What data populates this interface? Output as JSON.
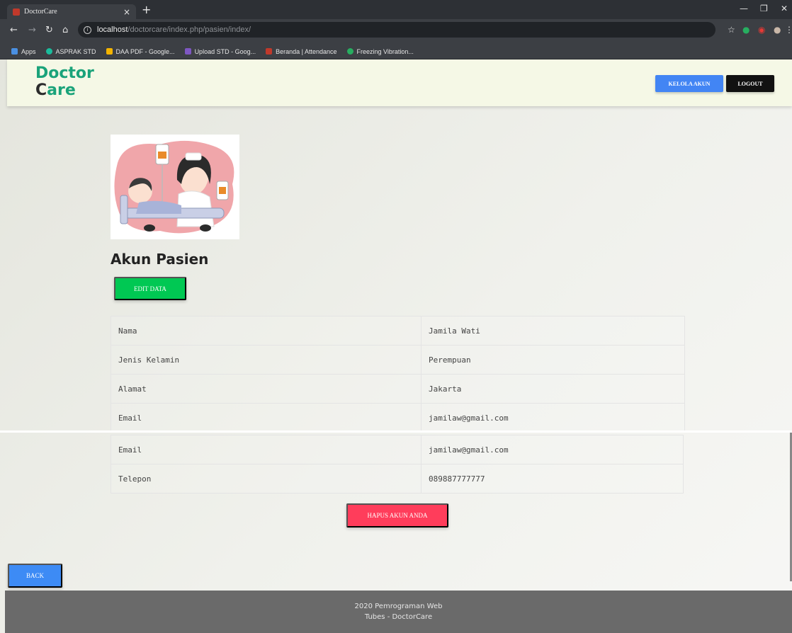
{
  "browser": {
    "tab_title": "DoctorCare",
    "url_host": "localhost",
    "url_path": "/doctorcare/index.php/pasien/index/",
    "bookmarks": [
      {
        "label": "Apps",
        "color": "#4a90e2"
      },
      {
        "label": "ASPRAK STD",
        "color": "#1abc9c"
      },
      {
        "label": "DAA PDF - Google...",
        "color": "#f4b400"
      },
      {
        "label": "Upload STD - Goog...",
        "color": "#7e57c2"
      },
      {
        "label": "Beranda | Attendance",
        "color": "#c0392b"
      },
      {
        "label": "Freezing Vibration...",
        "color": "#27ae60"
      }
    ]
  },
  "header": {
    "logo_line1": "Doctor",
    "logo_line2": "are",
    "kelola_label": "KELOLA AKUN",
    "logout_label": "LOGOUT"
  },
  "main": {
    "title": "Akun Pasien",
    "edit_label": "EDIT DATA",
    "rows_top": [
      {
        "label": "Nama",
        "value": "Jamila Wati"
      },
      {
        "label": "Jenis Kelamin",
        "value": "Perempuan"
      },
      {
        "label": "Alamat",
        "value": "Jakarta"
      },
      {
        "label": "Email",
        "value": "jamilaw@gmail.com"
      }
    ],
    "rows_bottom": [
      {
        "label": "Email",
        "value": "jamilaw@gmail.com"
      },
      {
        "label": "Telepon",
        "value": "089887777777"
      }
    ],
    "delete_label": "HAPUS AKUN ANDA",
    "back_label": "BACK"
  },
  "footer": {
    "line1": "2020 Pemrograman Web",
    "line2": "Tubes - DoctorCare"
  },
  "colors": {
    "brand": "#1aa37a",
    "primary": "#4285f4",
    "success": "#00c853",
    "danger": "#ff3d5b"
  }
}
